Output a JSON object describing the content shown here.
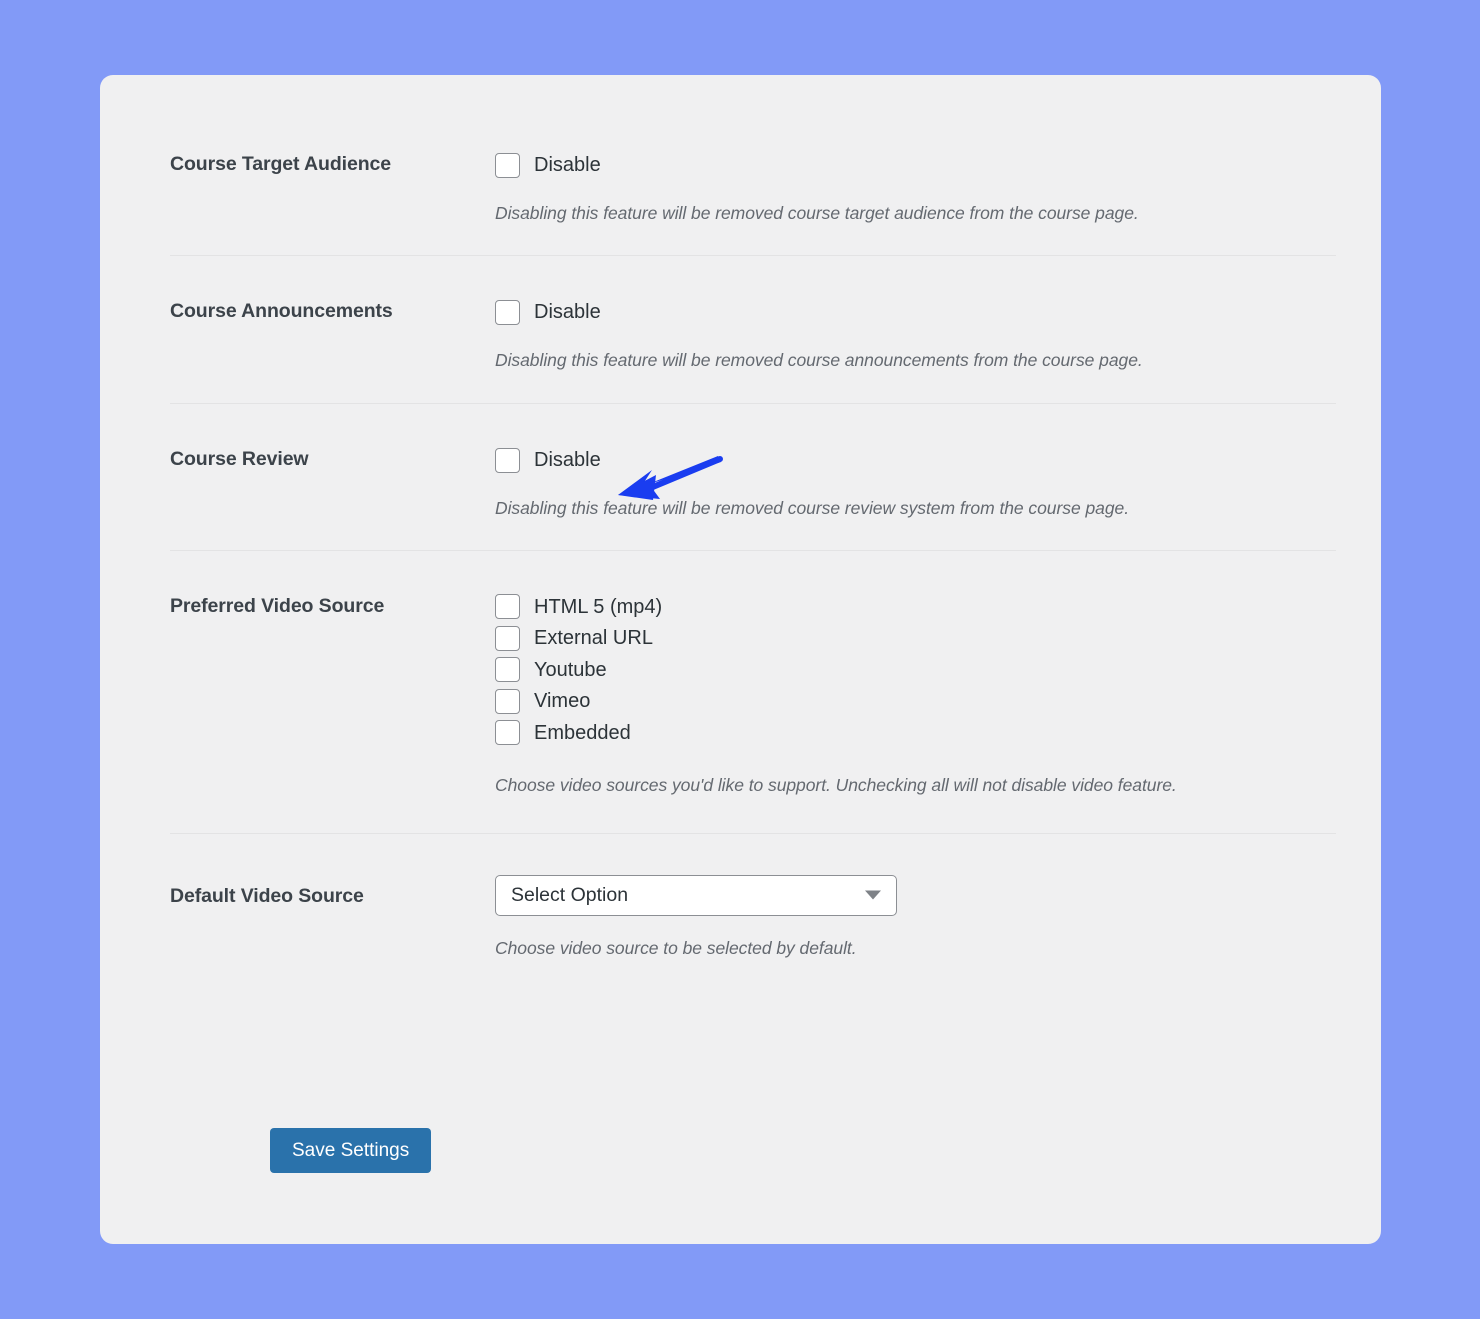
{
  "theme": {
    "page_background": "#829af7",
    "card_background": "#f0f0f1",
    "label_color": "#3c434a",
    "hint_color": "#646970",
    "accent_button": "#2a72ab",
    "annotation_color": "#1a3df0",
    "checkbox_border": "#8c8f94"
  },
  "settings": {
    "rows": [
      {
        "label": "Course Target Audience",
        "option_label": "Disable",
        "checked": false,
        "hint": "Disabling this feature will be removed course target audience from the course page."
      },
      {
        "label": "Course Announcements",
        "option_label": "Disable",
        "checked": false,
        "hint": "Disabling this feature will be removed course announcements from the course page."
      },
      {
        "label": "Course Review",
        "option_label": "Disable",
        "checked": false,
        "hint": "Disabling this feature will be removed course review system from the course page."
      }
    ],
    "preferred_video_source": {
      "label": "Preferred Video Source",
      "options": [
        {
          "label": "HTML 5 (mp4)",
          "checked": false
        },
        {
          "label": "External URL",
          "checked": false
        },
        {
          "label": "Youtube",
          "checked": false
        },
        {
          "label": "Vimeo",
          "checked": false
        },
        {
          "label": "Embedded",
          "checked": false
        }
      ],
      "hint": "Choose video sources you'd like to support. Unchecking all will not disable video feature."
    },
    "default_video_source": {
      "label": "Default Video Source",
      "selected": "Select Option",
      "hint": "Choose video source to be selected by default."
    },
    "save_label": "Save Settings"
  },
  "annotation": {
    "type": "arrow",
    "points_to": "Course Review Disable checkbox",
    "color": "#1a3df0"
  }
}
